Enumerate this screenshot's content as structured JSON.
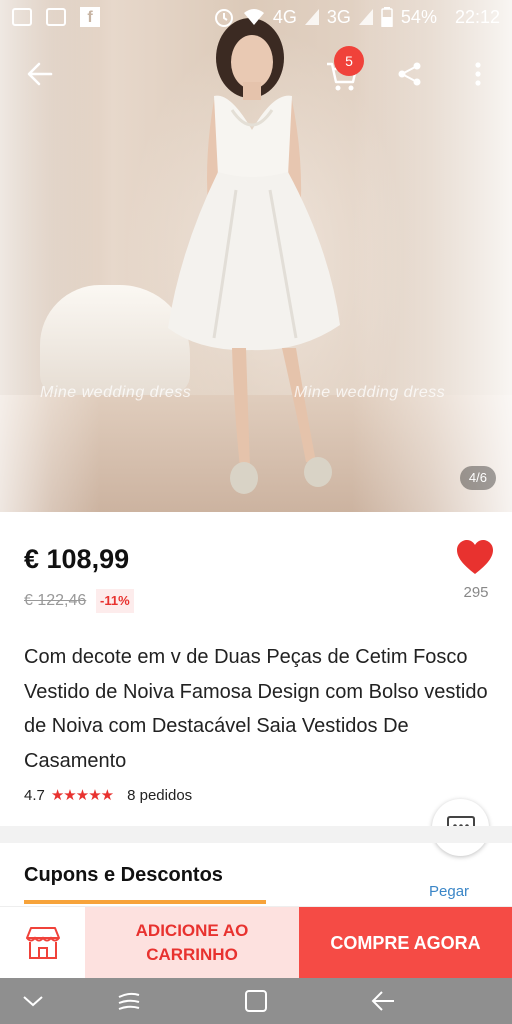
{
  "status_bar": {
    "network_1": "4G",
    "network_2": "3G",
    "battery": "54%",
    "time": "22:12"
  },
  "toolbar": {
    "cart_count": "5"
  },
  "gallery": {
    "watermark_1": "Mine wedding dress",
    "watermark_2": "Mine wedding dress",
    "pager": "4/6"
  },
  "product": {
    "price": "€ 108,99",
    "old_price": "€ 122,46",
    "discount": "-11%",
    "wishlist_count": "295",
    "title": "Com decote em v de Duas Peças de Cetim Fosco Vestido de Noiva Famosa Design com Bolso vestido de Noiva com Destacável Saia Vestidos De Casamento",
    "rating": "4.7",
    "stars": "★★★★★",
    "orders": "8 pedidos"
  },
  "coupons": {
    "title": "Cupons e Descontos",
    "link": "Pegar"
  },
  "actions": {
    "add_to_cart": "ADICIONE AO CARRINHO",
    "buy_now": "COMPRE AGORA"
  },
  "colors": {
    "accent_red": "#e8322f",
    "buy_button": "#f54b45",
    "add_cart_bg": "#fde1df",
    "link_blue": "#3b86c7",
    "coupon_underline": "#f7a33a"
  },
  "icons": [
    "back-arrow-icon",
    "cart-icon",
    "share-icon",
    "more-vertical-icon",
    "heart-icon",
    "star-icon",
    "chat-bubble-icon",
    "store-icon",
    "nav-down-icon",
    "recent-apps-icon",
    "home-icon",
    "nav-back-icon"
  ]
}
